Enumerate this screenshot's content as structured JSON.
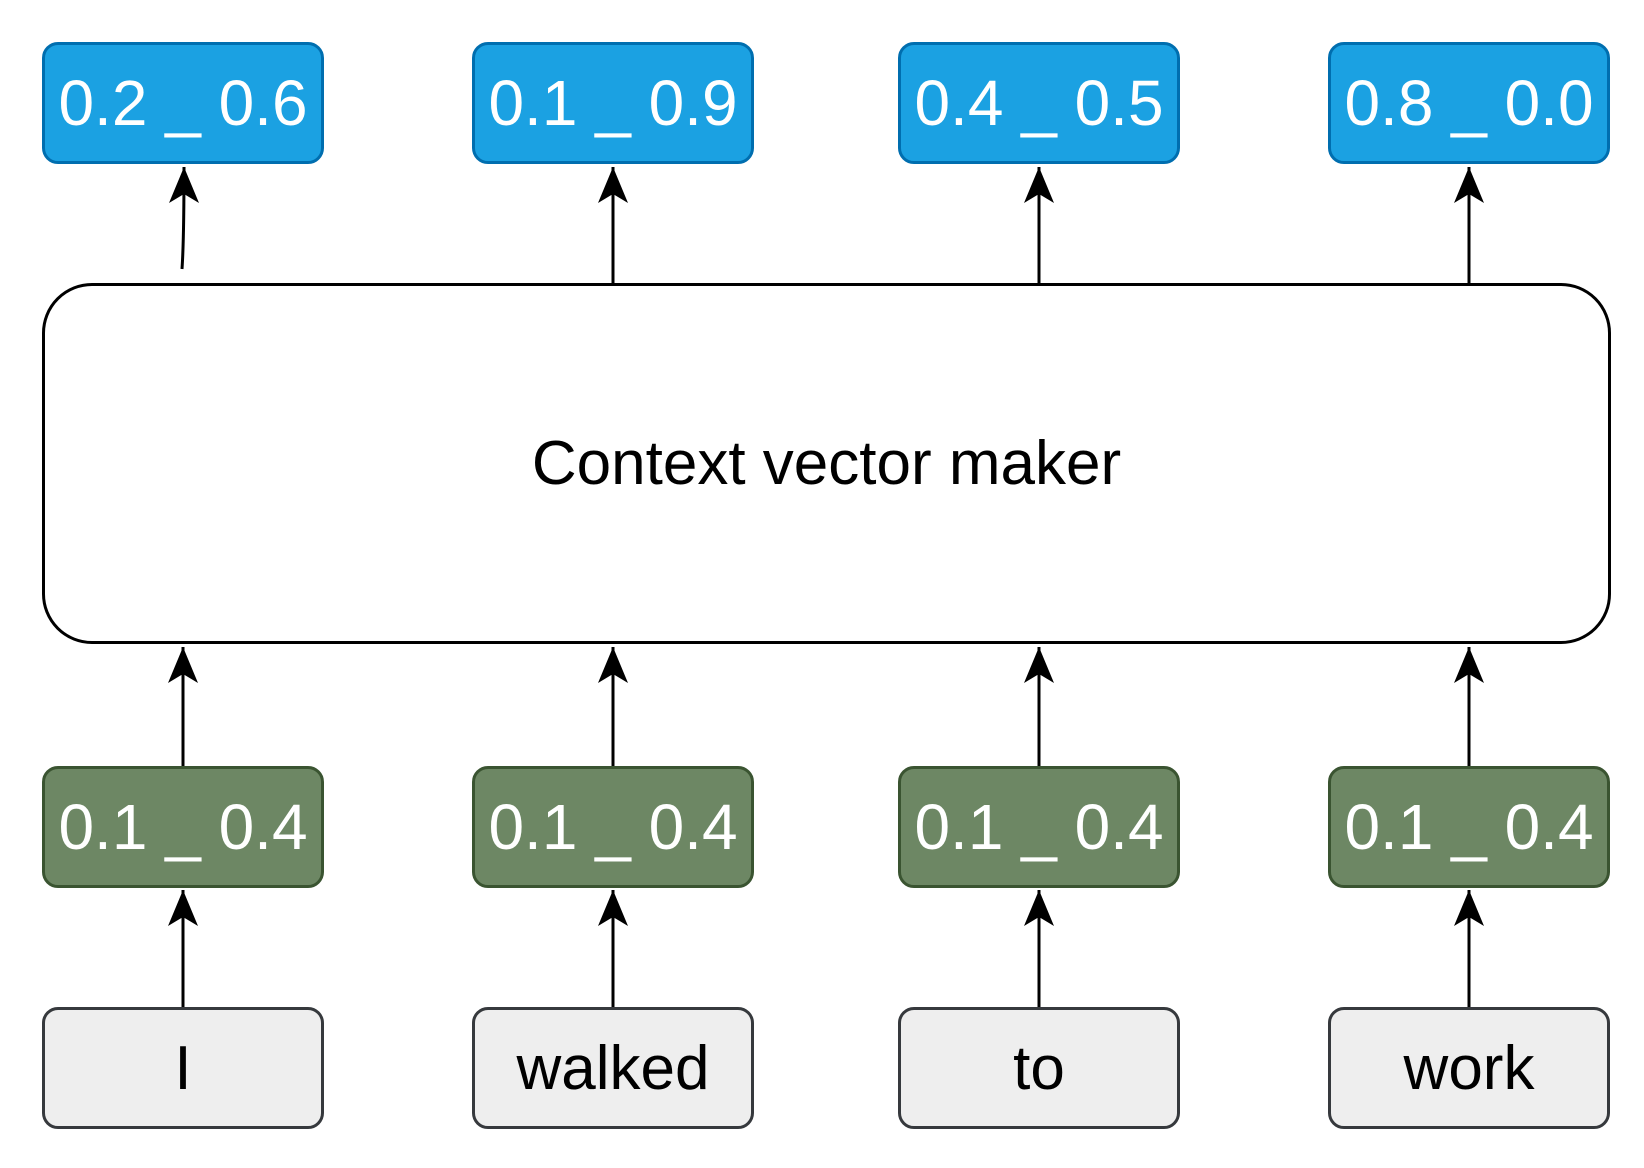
{
  "context_module": {
    "label": "Context vector maker"
  },
  "outputs": [
    {
      "label": "0.2 _ 0.6"
    },
    {
      "label": "0.1 _ 0.9"
    },
    {
      "label": "0.4 _ 0.5"
    },
    {
      "label": "0.8 _ 0.0"
    }
  ],
  "embeddings": [
    {
      "label": "0.1 _ 0.4"
    },
    {
      "label": "0.1 _ 0.4"
    },
    {
      "label": "0.1 _ 0.4"
    },
    {
      "label": "0.1 _ 0.4"
    }
  ],
  "words": [
    {
      "label": "I"
    },
    {
      "label": "walked"
    },
    {
      "label": "to"
    },
    {
      "label": "work"
    }
  ],
  "colors": {
    "output_fill": "#1ba1e2",
    "output_stroke": "#006eaf",
    "embedding_fill": "#6d8764",
    "embedding_stroke": "#3a5431",
    "word_fill": "#eeeeee",
    "word_stroke": "#36393d",
    "arrow": "#000000"
  }
}
